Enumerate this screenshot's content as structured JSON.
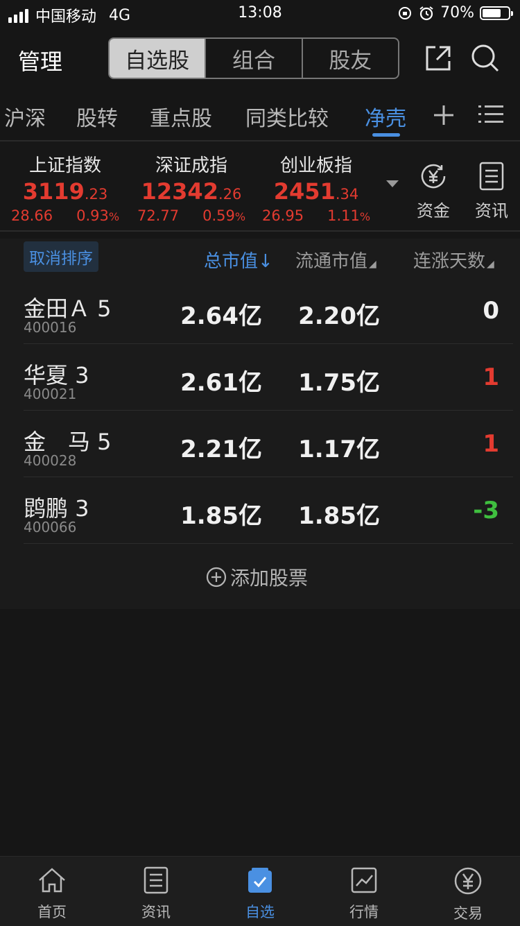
{
  "status_bar": {
    "carrier": "中国移动",
    "network": "4G",
    "time": "13:08",
    "battery": "70%"
  },
  "header": {
    "title": "管理",
    "segments": [
      {
        "label": "自选股",
        "active": true
      },
      {
        "label": "组合",
        "active": false
      },
      {
        "label": "股友",
        "active": false
      }
    ]
  },
  "tabs": [
    {
      "label": "沪深"
    },
    {
      "label": "股转"
    },
    {
      "label": "重点股"
    },
    {
      "label": "同类比较"
    },
    {
      "label": "净壳",
      "active": true
    }
  ],
  "indices": [
    {
      "name": "上证指数",
      "int": "3119",
      "dec": ".23",
      "change": "28.66",
      "pct": "0.93",
      "pct_sign": "%"
    },
    {
      "name": "深证成指",
      "int": "12342",
      "dec": ".26",
      "change": "72.77",
      "pct": "0.59",
      "pct_sign": "%"
    },
    {
      "name": "创业板指",
      "int": "2451",
      "dec": ".34",
      "change": "26.95",
      "pct": "1.11",
      "pct_sign": "%"
    }
  ],
  "panel_buttons": {
    "funds": "资金",
    "news": "资讯"
  },
  "sort_bar": {
    "cancel": "取消排序",
    "col_total_mv": "总市值↓",
    "col_float_mv": "流通市值",
    "col_streak": "连涨天数"
  },
  "stocks": [
    {
      "name": "金田Ａ 5",
      "code": "400016",
      "total_mv": "2.64亿",
      "float_mv": "2.20亿",
      "streak": "0",
      "streak_color": "#f0f0f0"
    },
    {
      "name": "华夏 3",
      "code": "400021",
      "total_mv": "2.61亿",
      "float_mv": "1.75亿",
      "streak": "1",
      "streak_color": "#e33b30"
    },
    {
      "name": "金　马 5",
      "code": "400028",
      "total_mv": "2.21亿",
      "float_mv": "1.17亿",
      "streak": "1",
      "streak_color": "#e33b30"
    },
    {
      "name": "鹍鹏 3",
      "code": "400066",
      "total_mv": "1.85亿",
      "float_mv": "1.85亿",
      "streak": "-3",
      "streak_color": "#3fbf3f"
    }
  ],
  "add_stock": "添加股票",
  "tabbar": [
    {
      "label": "首页",
      "icon": "home-icon"
    },
    {
      "label": "资讯",
      "icon": "news-icon"
    },
    {
      "label": "自选",
      "icon": "watchlist-icon",
      "active": true
    },
    {
      "label": "行情",
      "icon": "market-chart-icon"
    },
    {
      "label": "交易",
      "icon": "yen-trade-icon"
    }
  ],
  "colors": {
    "accent": "#4a90e2",
    "up": "#e33b30",
    "down": "#3fbf3f",
    "background": "#161616"
  }
}
